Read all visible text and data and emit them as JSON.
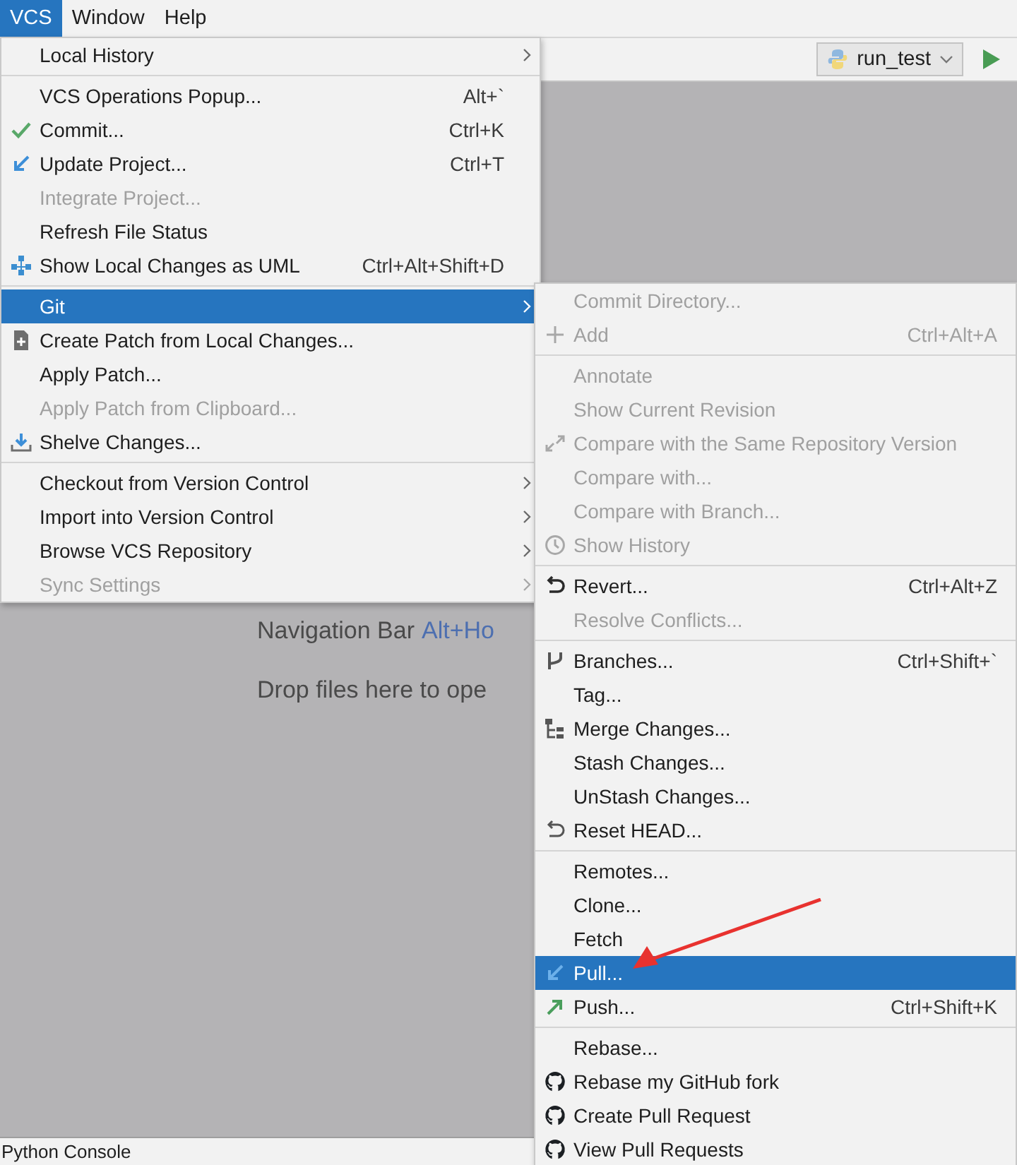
{
  "menubar": {
    "items": [
      {
        "label": "VCS",
        "selected": true
      },
      {
        "label": "Window",
        "selected": false
      },
      {
        "label": "Help",
        "selected": false
      }
    ]
  },
  "toolbar": {
    "run_configuration": "run_test"
  },
  "editor": {
    "hints": [
      {
        "text": "Navigation Bar",
        "shortcut": "Alt+Ho"
      },
      {
        "text": "Drop files here to ope"
      }
    ]
  },
  "vcs_menu": {
    "groups": [
      {
        "items": [
          {
            "label": "Local History",
            "submenu": true,
            "disabled": false,
            "selected": false
          }
        ]
      },
      {
        "items": [
          {
            "label": "VCS Operations Popup...",
            "shortcut": "Alt+`",
            "submenu": false,
            "disabled": false,
            "selected": false
          },
          {
            "label": "Commit...",
            "shortcut": "Ctrl+K",
            "kind": "check",
            "submenu": false,
            "disabled": false,
            "selected": false
          },
          {
            "label": "Update Project...",
            "shortcut": "Ctrl+T",
            "kind": "update",
            "submenu": false,
            "disabled": false,
            "selected": false
          },
          {
            "label": "Integrate Project...",
            "submenu": false,
            "disabled": true,
            "selected": false
          },
          {
            "label": "Refresh File Status",
            "submenu": false,
            "disabled": false,
            "selected": false
          },
          {
            "label": "Show Local Changes as UML",
            "shortcut": "Ctrl+Alt+Shift+D",
            "kind": "uml",
            "submenu": false,
            "disabled": false,
            "selected": false
          }
        ]
      },
      {
        "items": [
          {
            "label": "Git",
            "submenu": true,
            "disabled": false,
            "selected": true
          },
          {
            "label": "Create Patch from Local Changes...",
            "kind": "patch",
            "submenu": false,
            "disabled": false,
            "selected": false
          },
          {
            "label": "Apply Patch...",
            "submenu": false,
            "disabled": false,
            "selected": false
          },
          {
            "label": "Apply Patch from Clipboard...",
            "submenu": false,
            "disabled": true,
            "selected": false
          },
          {
            "label": "Shelve Changes...",
            "kind": "shelve",
            "submenu": false,
            "disabled": false,
            "selected": false
          }
        ]
      },
      {
        "items": [
          {
            "label": "Checkout from Version Control",
            "submenu": true,
            "disabled": false,
            "selected": false
          },
          {
            "label": "Import into Version Control",
            "submenu": true,
            "disabled": false,
            "selected": false
          },
          {
            "label": "Browse VCS Repository",
            "submenu": true,
            "disabled": false,
            "selected": false
          },
          {
            "label": "Sync Settings",
            "submenu": true,
            "disabled": true,
            "selected": false
          }
        ]
      }
    ]
  },
  "git_submenu": {
    "groups": [
      {
        "items": [
          {
            "label": "Commit Directory...",
            "disabled": true,
            "selected": false
          },
          {
            "label": "Add",
            "shortcut": "Ctrl+Alt+A",
            "kind": "plus",
            "disabled": true,
            "selected": false
          }
        ]
      },
      {
        "items": [
          {
            "label": "Annotate",
            "disabled": true,
            "selected": false
          },
          {
            "label": "Show Current Revision",
            "disabled": true,
            "selected": false
          },
          {
            "label": "Compare with the Same Repository Version",
            "kind": "compare",
            "disabled": true,
            "selected": false
          },
          {
            "label": "Compare with...",
            "disabled": true,
            "selected": false
          },
          {
            "label": "Compare with Branch...",
            "disabled": true,
            "selected": false
          },
          {
            "label": "Show History",
            "kind": "history",
            "disabled": true,
            "selected": false
          }
        ]
      },
      {
        "items": [
          {
            "label": "Revert...",
            "shortcut": "Ctrl+Alt+Z",
            "kind": "revert",
            "disabled": false,
            "selected": false
          },
          {
            "label": "Resolve Conflicts...",
            "disabled": true,
            "selected": false
          }
        ]
      },
      {
        "items": [
          {
            "label": "Branches...",
            "shortcut": "Ctrl+Shift+`",
            "kind": "branch",
            "disabled": false,
            "selected": false
          },
          {
            "label": "Tag...",
            "disabled": false,
            "selected": false
          },
          {
            "label": "Merge Changes...",
            "kind": "merge",
            "disabled": false,
            "selected": false
          },
          {
            "label": "Stash Changes...",
            "disabled": false,
            "selected": false
          },
          {
            "label": "UnStash Changes...",
            "disabled": false,
            "selected": false
          },
          {
            "label": "Reset HEAD...",
            "kind": "reset",
            "disabled": false,
            "selected": false
          }
        ]
      },
      {
        "items": [
          {
            "label": "Remotes...",
            "disabled": false,
            "selected": false
          },
          {
            "label": "Clone...",
            "disabled": false,
            "selected": false
          },
          {
            "label": "Fetch",
            "disabled": false,
            "selected": false
          },
          {
            "label": "Pull...",
            "kind": "pull",
            "disabled": false,
            "selected": true
          },
          {
            "label": "Push...",
            "shortcut": "Ctrl+Shift+K",
            "kind": "push",
            "disabled": false,
            "selected": false
          }
        ]
      },
      {
        "items": [
          {
            "label": "Rebase...",
            "disabled": false,
            "selected": false
          },
          {
            "label": "Rebase my GitHub fork",
            "kind": "github",
            "disabled": false,
            "selected": false
          },
          {
            "label": "Create Pull Request",
            "kind": "github",
            "disabled": false,
            "selected": false
          },
          {
            "label": "View Pull Requests",
            "kind": "github",
            "disabled": false,
            "selected": false
          }
        ]
      }
    ]
  },
  "status_bar": {
    "tool_window": "Python Console"
  }
}
